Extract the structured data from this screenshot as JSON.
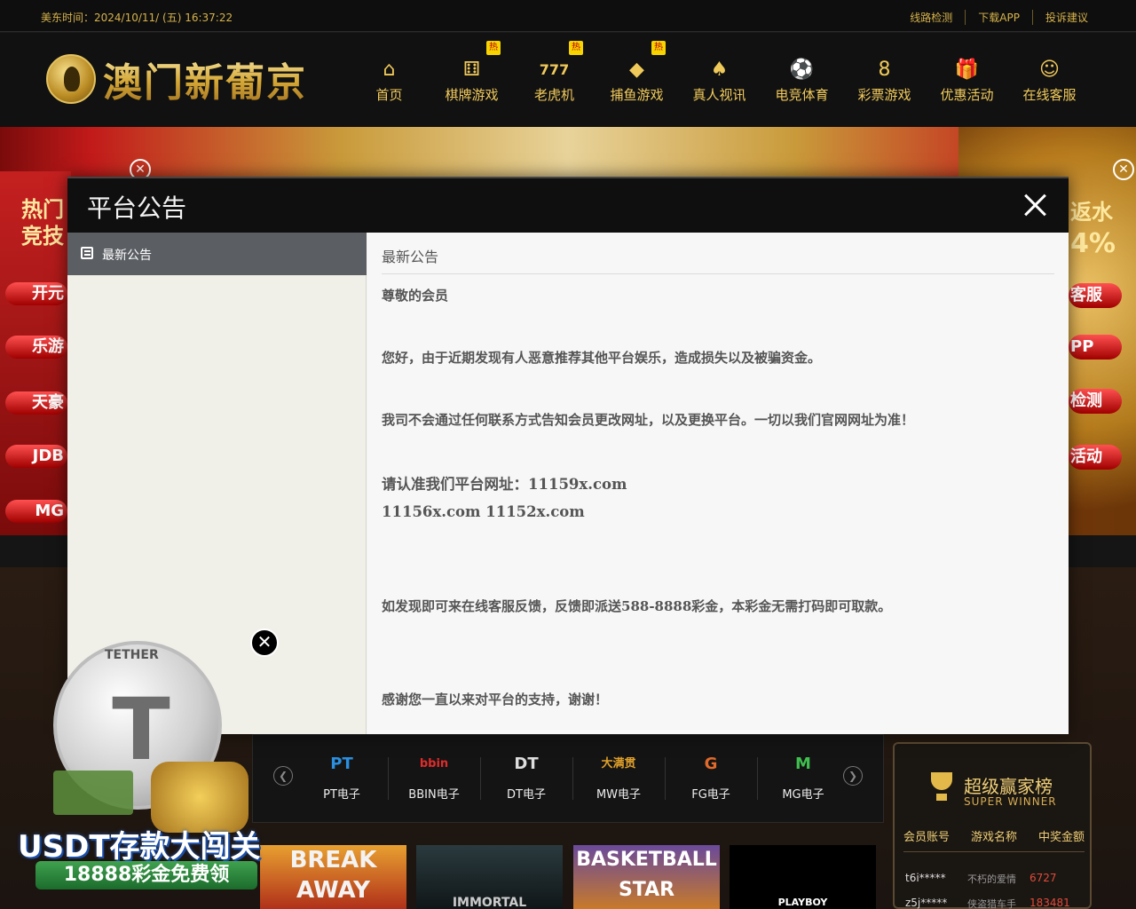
{
  "topbar": {
    "time_label": "美东时间：",
    "time_value": "2024/10/11/ (五) 16:37:22",
    "links": [
      "线路检测",
      "下载APP",
      "投诉建议"
    ]
  },
  "header": {
    "logo_text": "澳门新葡京",
    "nav": [
      {
        "label": "首页",
        "icon": "home-icon",
        "glyph": "⌂",
        "hot": false
      },
      {
        "label": "棋牌游戏",
        "icon": "dice-icon",
        "glyph": "⚅",
        "hot": true
      },
      {
        "label": "老虎机",
        "icon": "slot-777-icon",
        "glyph": "777",
        "hot": true
      },
      {
        "label": "捕鱼游戏",
        "icon": "fish-icon",
        "glyph": "◆",
        "hot": true
      },
      {
        "label": "真人视讯",
        "icon": "cards-icon",
        "glyph": "♠",
        "hot": false
      },
      {
        "label": "电竞体育",
        "icon": "soccer-ball-icon",
        "glyph": "⚽",
        "hot": false
      },
      {
        "label": "彩票游戏",
        "icon": "lottery-ball-icon",
        "glyph": "8",
        "hot": false
      },
      {
        "label": "优惠活动",
        "icon": "gift-icon",
        "glyph": "🎁",
        "hot": false
      },
      {
        "label": "在线客服",
        "icon": "support-agent-icon",
        "glyph": "☺",
        "hot": false
      }
    ],
    "hot_badge": "热"
  },
  "banner": {
    "left_pills": [
      "开元",
      "乐游",
      "天豪",
      "JDB",
      "MG"
    ],
    "left_heading": [
      "热门",
      "竞技"
    ],
    "right_pills": [
      "客服",
      "PP",
      "检测",
      "活动"
    ],
    "right_heading": [
      "返水",
      "4%"
    ]
  },
  "modal": {
    "title": "平台公告",
    "sidebar_item": "最新公告",
    "content_title": "最新公告",
    "paragraphs": [
      "尊敬的会员",
      "您好，由于近期发现有人恶意推荐其他平台娱乐，造成损失以及被骗资金。",
      "我司不会通过任何联系方式告知会员更改网址，以及更换平台。一切以我们官网网址为准！",
      "请认准我们平台网址：11159x.com",
      "11156x.com  11152x.com",
      "如发现即可来在线客服反馈，反馈即派送588-8888彩金，本彩金无需打码即可取款。",
      "感谢您一直以来对平台的支持，谢谢！"
    ]
  },
  "games": {
    "brands": [
      {
        "label": "PT电子",
        "icon": "pt-logo-icon",
        "glyph": "PT",
        "color": "#2b8fe0"
      },
      {
        "label": "BBIN电子",
        "icon": "bbin-logo-icon",
        "glyph": "bbin",
        "color": "#e02b2b"
      },
      {
        "label": "DT电子",
        "icon": "dt-logo-icon",
        "glyph": "DT",
        "color": "#dddddd"
      },
      {
        "label": "MW电子",
        "icon": "mw-logo-icon",
        "glyph": "大满贯",
        "color": "#e0a02b"
      },
      {
        "label": "FG电子",
        "icon": "fg-logo-icon",
        "glyph": "G",
        "color": "#e06a2b"
      },
      {
        "label": "MG电子",
        "icon": "mg-logo-icon",
        "glyph": "M",
        "color": "#3fbf4f"
      }
    ],
    "thumbs": [
      "BREAK AWAY",
      "IMMORTAL",
      "BASKETBALL STAR",
      "PLAYBOY"
    ]
  },
  "winner": {
    "title": "超级赢家榜",
    "subtitle": "SUPER WINNER",
    "columns": [
      "会员账号",
      "游戏名称",
      "中奖金额"
    ],
    "rows": [
      {
        "user": "t6i*****",
        "game": "不朽的爱情",
        "amount": "6727"
      },
      {
        "user": "z5j*****",
        "game": "侠盗猎车手",
        "amount": "183481"
      }
    ]
  },
  "promo": {
    "title": "USDT存款大闯关",
    "subtitle": "18888彩金免费领",
    "coin_ring": "TETHER",
    "coin_mark": "T"
  }
}
